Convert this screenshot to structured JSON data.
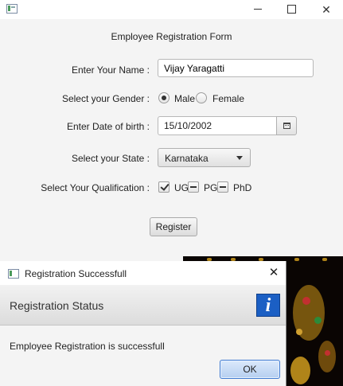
{
  "main_window": {
    "form_title": "Employee Registration Form",
    "name": {
      "label": "Enter Your Name :",
      "value": "Vijay Yaragatti"
    },
    "gender": {
      "label": "Select your Gender :",
      "options": [
        {
          "label": "Male",
          "selected": true
        },
        {
          "label": "Female",
          "selected": false
        }
      ]
    },
    "dob": {
      "label": "Enter Date of birth :",
      "value": "15/10/2002"
    },
    "state": {
      "label": "Select your State :",
      "value": "Karnataka"
    },
    "qualification": {
      "label": "Select Your Qualification :",
      "options": [
        {
          "label": "UG",
          "state": "checked"
        },
        {
          "label": "PG",
          "state": "indeterminate"
        },
        {
          "label": "PhD",
          "state": "indeterminate"
        }
      ]
    },
    "register_label": "Register"
  },
  "dialog": {
    "title": "Registration Successfull",
    "header": "Registration Status",
    "info_icon_glyph": "i",
    "content": "Employee Registration is successfull",
    "ok_label": "OK"
  },
  "colors": {
    "window_bg": "#f4f4f4",
    "info_icon_bg": "#1b5fc4",
    "ok_button_border": "#3f7ad1"
  }
}
